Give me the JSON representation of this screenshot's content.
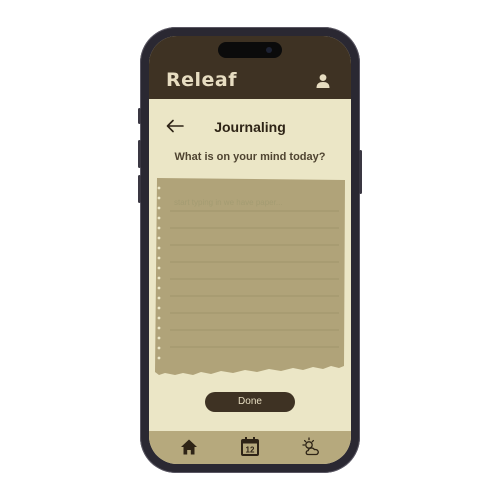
{
  "app": {
    "brand": "Releaf"
  },
  "page": {
    "title": "Journaling",
    "prompt": "What is on your mind today?"
  },
  "journal": {
    "placeholder": "start typing in we have paper..."
  },
  "actions": {
    "done_label": "Done"
  },
  "tabbar": {
    "items": [
      {
        "icon": "home-icon"
      },
      {
        "icon": "calendar-icon",
        "label": "12"
      },
      {
        "icon": "weather-icon"
      }
    ]
  },
  "colors": {
    "header": "#3e3223",
    "background": "#ebe6c6",
    "paper": "#b0a379",
    "tabbar": "#b6a97d"
  }
}
